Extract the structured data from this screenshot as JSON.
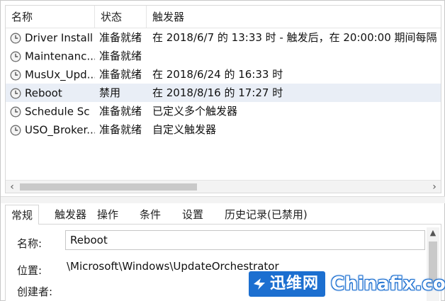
{
  "columns": {
    "name": "名称",
    "status": "状态",
    "triggers": "触发器"
  },
  "tasks": [
    {
      "name": "Driver Install",
      "status": "准备就绪",
      "trigger": "在 2018/6/7 的 13:33 时 - 触发后，在 20:00:00 期间每隔 1 小",
      "selected": false
    },
    {
      "name": "Maintenanc...",
      "status": "准备就绪",
      "trigger": "",
      "selected": false
    },
    {
      "name": "MusUx_Upd...",
      "status": "准备就绪",
      "trigger": "在 2018/6/24 的 16:33 时",
      "selected": false
    },
    {
      "name": "Reboot",
      "status": "禁用",
      "trigger": "在 2018/8/16 的 17:27 时",
      "selected": true
    },
    {
      "name": "Schedule Sc",
      "status": "准备就绪",
      "trigger": "已定义多个触发器",
      "selected": false
    },
    {
      "name": "USO_Broker...",
      "status": "准备就绪",
      "trigger": "自定义触发器",
      "selected": false
    }
  ],
  "scroll": {
    "left": "‹",
    "right": "›",
    "up": "▲"
  },
  "tabs": [
    {
      "label": "常规",
      "active": true
    },
    {
      "label": "触发器",
      "active": false
    },
    {
      "label": "操作",
      "active": false
    },
    {
      "label": "条件",
      "active": false
    },
    {
      "label": "设置",
      "active": false
    },
    {
      "label": "历史记录(已禁用)",
      "active": false
    }
  ],
  "details": {
    "name_label": "名称:",
    "name_value": "Reboot",
    "location_label": "位置:",
    "location_value": "\\Microsoft\\Windows\\UpdateOrchestrator",
    "author_label": "创建者:"
  },
  "watermark": {
    "cn": "迅维网",
    "en": "Chinafix.com"
  },
  "colors": {
    "selected_row": "#e9eef6",
    "watermark_blue": "#1c6fd0"
  },
  "icons": {
    "task": "clock-icon"
  }
}
